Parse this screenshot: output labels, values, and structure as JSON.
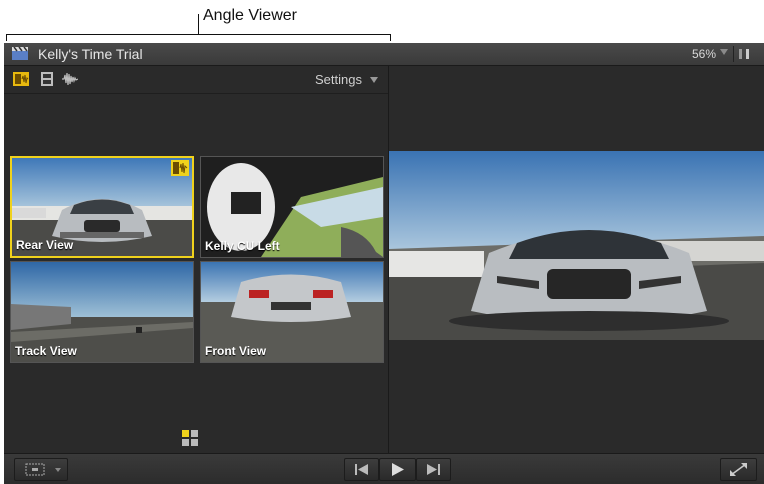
{
  "annotation": {
    "label": "Angle Viewer"
  },
  "window": {
    "title": "Kelly's Time Trial",
    "zoom": "56%"
  },
  "angle_viewer": {
    "settings_label": "Settings",
    "angles": [
      {
        "label": "Rear View",
        "active": true
      },
      {
        "label": "Kelly CU Left",
        "active": false
      },
      {
        "label": "Track View",
        "active": false
      },
      {
        "label": "Front View",
        "active": false
      }
    ]
  },
  "colors": {
    "active_border": "#f0d21c",
    "background": "#2a2a2a"
  },
  "icons": [
    "clapperboard-icon",
    "video-audio-switch-icon",
    "video-only-icon",
    "audio-only-icon",
    "audio-meter-icon",
    "angle-badge-icon",
    "angle-grid-icon",
    "view-options-icon",
    "previous-edit-icon",
    "play-icon",
    "next-edit-icon",
    "fullscreen-icon"
  ]
}
